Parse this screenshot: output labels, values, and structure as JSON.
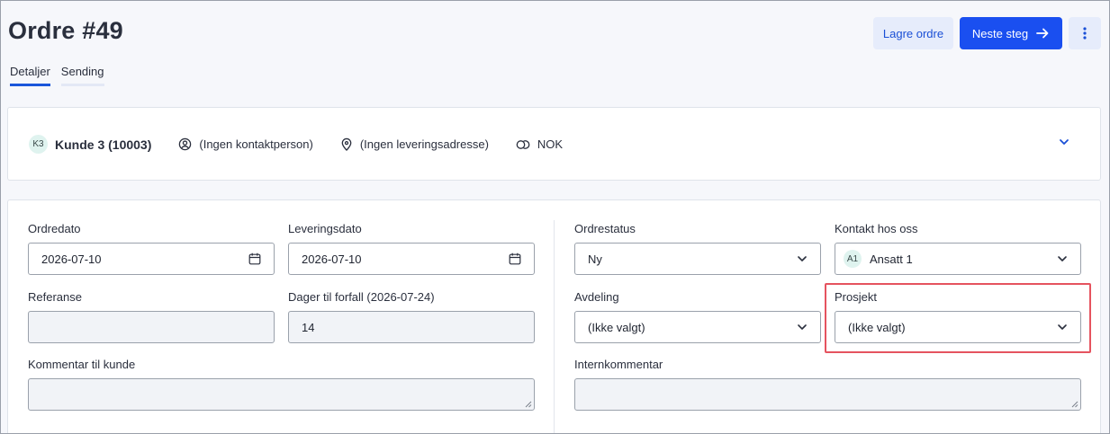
{
  "header": {
    "title": "Ordre #49",
    "save_label": "Lagre ordre",
    "next_label": "Neste steg"
  },
  "tabs": [
    {
      "label": "Detaljer",
      "active": true
    },
    {
      "label": "Sending",
      "active": false
    }
  ],
  "customer": {
    "avatar": "K3",
    "name": "Kunde 3 (10003)",
    "contact": "(Ingen kontaktperson)",
    "address": "(Ingen leveringsadresse)",
    "currency": "NOK"
  },
  "form": {
    "order_date": {
      "label": "Ordredato",
      "value": "2026-07-10"
    },
    "delivery_date": {
      "label": "Leveringsdato",
      "value": "2026-07-10"
    },
    "reference": {
      "label": "Referanse",
      "value": ""
    },
    "due_days": {
      "label": "Dager til forfall (2026-07-24)",
      "value": "14"
    },
    "customer_comment": {
      "label": "Kommentar til kunde",
      "value": ""
    },
    "order_status": {
      "label": "Ordrestatus",
      "value": "Ny"
    },
    "our_contact": {
      "label": "Kontakt hos oss",
      "avatar": "A1",
      "value": "Ansatt 1"
    },
    "department": {
      "label": "Avdeling",
      "value": "(Ikke valgt)"
    },
    "project": {
      "label": "Prosjekt",
      "value": "(Ikke valgt)"
    },
    "internal_comment": {
      "label": "Internkommentar",
      "value": ""
    }
  },
  "colors": {
    "accent": "#1a4ff0",
    "highlight": "#e5535f",
    "background": "#f6f7fb"
  }
}
